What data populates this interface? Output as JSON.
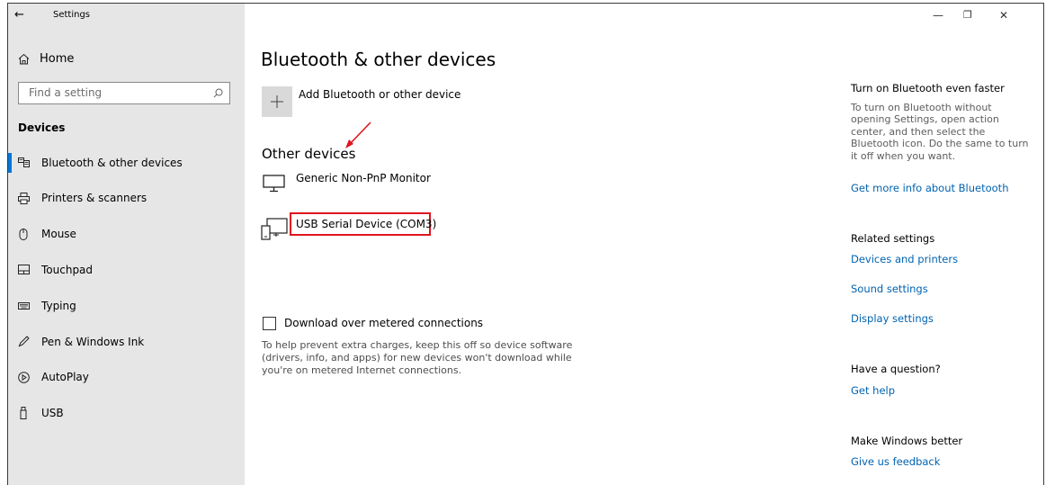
{
  "window": {
    "title": "Settings",
    "back_glyph": "←",
    "minimize_glyph": "—",
    "maximize_glyph": "❐",
    "close_glyph": "✕"
  },
  "sidebar": {
    "home_label": "Home",
    "search_placeholder": "Find a setting",
    "section_label": "Devices",
    "items": [
      {
        "label": "Bluetooth & other devices",
        "icon": "bluetooth-devices-icon",
        "selected": true
      },
      {
        "label": "Printers & scanners",
        "icon": "printer-icon"
      },
      {
        "label": "Mouse",
        "icon": "mouse-icon"
      },
      {
        "label": "Touchpad",
        "icon": "touchpad-icon"
      },
      {
        "label": "Typing",
        "icon": "keyboard-icon"
      },
      {
        "label": "Pen & Windows Ink",
        "icon": "pen-icon"
      },
      {
        "label": "AutoPlay",
        "icon": "autoplay-icon"
      },
      {
        "label": "USB",
        "icon": "usb-icon"
      }
    ]
  },
  "main": {
    "title": "Bluetooth & other devices",
    "add_device_label": "Add Bluetooth or other device",
    "other_devices_heading": "Other devices",
    "devices": [
      {
        "name": "Generic Non-PnP Monitor",
        "icon": "monitor-icon"
      },
      {
        "name": "USB Serial Device (COM3)",
        "icon": "serial-device-icon",
        "highlighted": true
      }
    ],
    "metered_label": "Download over metered connections",
    "metered_checked": false,
    "metered_help": "To help prevent extra charges, keep this off so device software (drivers, info, and apps) for new devices won't download while you're on metered Internet connections."
  },
  "right_panel": {
    "bt_faster_heading": "Turn on Bluetooth even faster",
    "bt_faster_text": "To turn on Bluetooth without opening Settings, open action center, and then select the Bluetooth icon. Do the same to turn it off when you want.",
    "bt_more_link": "Get more info about Bluetooth",
    "related_heading": "Related settings",
    "related_links": [
      "Devices and printers",
      "Sound settings",
      "Display settings"
    ],
    "question_heading": "Have a question?",
    "help_link": "Get help",
    "better_heading": "Make Windows better",
    "feedback_link": "Give us feedback"
  },
  "colors": {
    "accent": "#0078d7",
    "link": "#0063b1",
    "highlight_box": "#e0141f",
    "sidebar_bg": "#e6e6e6"
  }
}
